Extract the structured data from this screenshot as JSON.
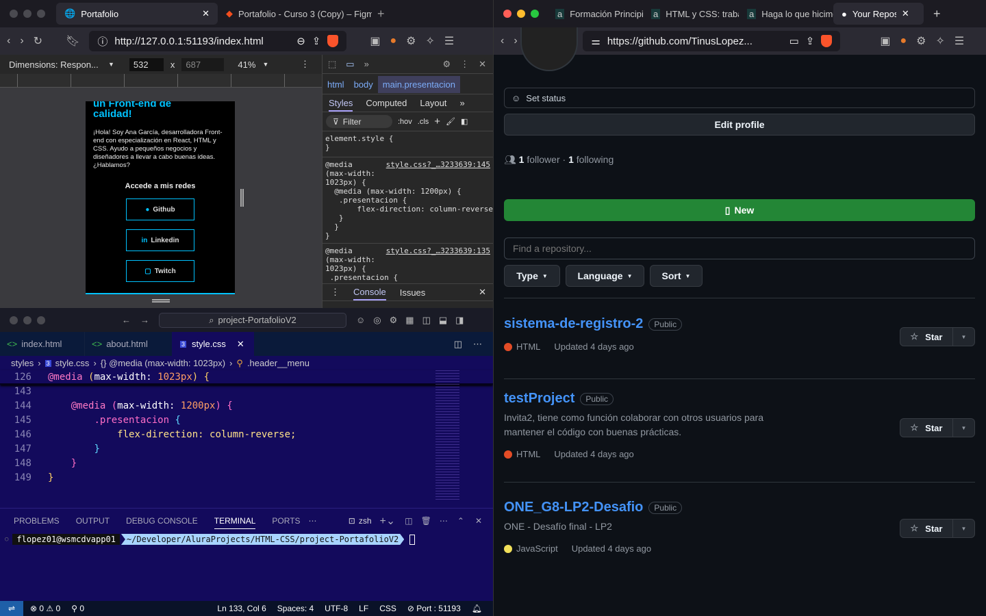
{
  "left_browser": {
    "tabs": [
      {
        "label": "Portafolio",
        "active": true
      },
      {
        "label": "Portafolio - Curso 3 (Copy) – Figma",
        "active": false
      }
    ],
    "url": "http://127.0.0.1:51193/index.html",
    "devtools_bar": {
      "dimensions": "Dimensions: Respon...",
      "width": "532",
      "x": "x",
      "height": "687",
      "zoom": "41%"
    },
    "page": {
      "heading": "un Front-end de calidad!",
      "body": "¡Hola! Soy Ana García, desarrolladora Front-end con especialización en React, HTML y CSS. Ayudo a pequeños negocios y diseñadores a llevar a cabo buenas ideas. ¿Hablamos?",
      "social_title": "Accede a mis redes",
      "buttons": [
        "Github",
        "Linkedin",
        "Twitch"
      ],
      "accent": "#00c2ff"
    },
    "devtools": {
      "breadcrumb": [
        "html",
        "body",
        "main.presentacion"
      ],
      "tabs": [
        "Styles",
        "Computed",
        "Layout"
      ],
      "filter_placeholder": "Filter",
      "hov": ":hov",
      "cls": ".cls",
      "rule1": "element.style {\n}",
      "rule2_src": "style.css?_…3233639:145",
      "rule2_media": "@media\n(max-width:\n1023px) {",
      "rule2_body": "  @media (max-width: 1200px) {\n   .presentacion {\n       flex-direction: column-reverse;\n   }\n  }\n}",
      "rule3_src": "style.css?_…3233639:135",
      "rule3_media": "@media\n(max-width:\n1023px) {",
      "rule3_body": " .presentacion {",
      "drawer_tabs": [
        "Console",
        "Issues"
      ]
    }
  },
  "vscode": {
    "search": "project-PortafolioV2",
    "tabs": [
      {
        "label": "index.html",
        "icon": "html"
      },
      {
        "label": "about.html",
        "icon": "html"
      },
      {
        "label": "style.css",
        "icon": "css",
        "active": true
      }
    ],
    "breadcrumb": [
      "styles",
      "style.css",
      "{} @media (max-width: 1023px)",
      ".header__menu"
    ],
    "sticky": {
      "n": "126",
      "code": [
        [
          "k",
          "@media "
        ],
        [
          "y",
          "("
        ],
        [
          "w",
          "max-width: "
        ],
        [
          "o",
          "1023px"
        ],
        [
          "y",
          ") {"
        ]
      ]
    },
    "lines": [
      {
        "n": "143",
        "code": []
      },
      {
        "n": "144",
        "code": [
          [
            "w",
            "    "
          ],
          [
            "k",
            "@media "
          ],
          [
            "p",
            "("
          ],
          [
            "w",
            "max-width: "
          ],
          [
            "o",
            "1200px"
          ],
          [
            "p",
            ") {"
          ]
        ]
      },
      {
        "n": "145",
        "code": [
          [
            "w",
            "        "
          ],
          [
            "p",
            ".presentacion "
          ],
          [
            "b",
            "{"
          ]
        ]
      },
      {
        "n": "146",
        "code": [
          [
            "w",
            "            "
          ],
          [
            "f",
            "flex-direction: column-reverse;"
          ]
        ]
      },
      {
        "n": "147",
        "code": [
          [
            "w",
            "        "
          ],
          [
            "b",
            "}"
          ]
        ]
      },
      {
        "n": "148",
        "code": [
          [
            "w",
            "    "
          ],
          [
            "p",
            "}"
          ]
        ]
      },
      {
        "n": "149",
        "code": [
          [
            "y",
            "}"
          ]
        ]
      }
    ],
    "panel_tabs": [
      "PROBLEMS",
      "OUTPUT",
      "DEBUG CONSOLE",
      "TERMINAL",
      "PORTS"
    ],
    "active_panel": "TERMINAL",
    "shell": "zsh",
    "prompt_user": "flopez01@wsmcdvapp01",
    "prompt_path": "~/Developer/AluraProjects/HTML-CSS/project-PortafolioV2",
    "status": {
      "errors": "0",
      "warnings": "0",
      "ports": "0",
      "position": "Ln 133, Col 6",
      "spaces": "Spaces: 4",
      "encoding": "UTF-8",
      "eol": "LF",
      "language": "CSS",
      "port": "Port : 51193"
    }
  },
  "right_browser": {
    "tabs": [
      {
        "label": "Formación Principiante"
      },
      {
        "label": "HTML y CSS: trabajando"
      },
      {
        "label": "Haga lo que hicimos"
      },
      {
        "label": "Your Repositories",
        "active": true
      }
    ],
    "url": "https://github.com/TinusLopez...",
    "github": {
      "set_status": "Set status",
      "edit_profile": "Edit profile",
      "followers": "1",
      "followers_label": "follower",
      "following": "1",
      "following_label": "following",
      "new_button": "New",
      "find_placeholder": "Find a repository...",
      "filters": [
        "Type",
        "Language",
        "Sort"
      ],
      "repos": [
        {
          "name": "sistema-de-registro-2",
          "visibility": "Public",
          "description": "",
          "language": "HTML",
          "lang_color": "#e34c26",
          "updated": "Updated 4 days ago"
        },
        {
          "name": "testProject",
          "visibility": "Public",
          "description": "Invita2, tiene como función colaborar con otros usuarios para mantener el código con buenas prácticas.",
          "language": "HTML",
          "lang_color": "#e34c26",
          "updated": "Updated 4 days ago"
        },
        {
          "name": "ONE_G8-LP2-Desafio",
          "visibility": "Public",
          "description": "ONE - Desafío final - LP2",
          "language": "JavaScript",
          "lang_color": "#f1e05a",
          "updated": "Updated 4 days ago"
        }
      ],
      "star_label": "Star"
    }
  }
}
